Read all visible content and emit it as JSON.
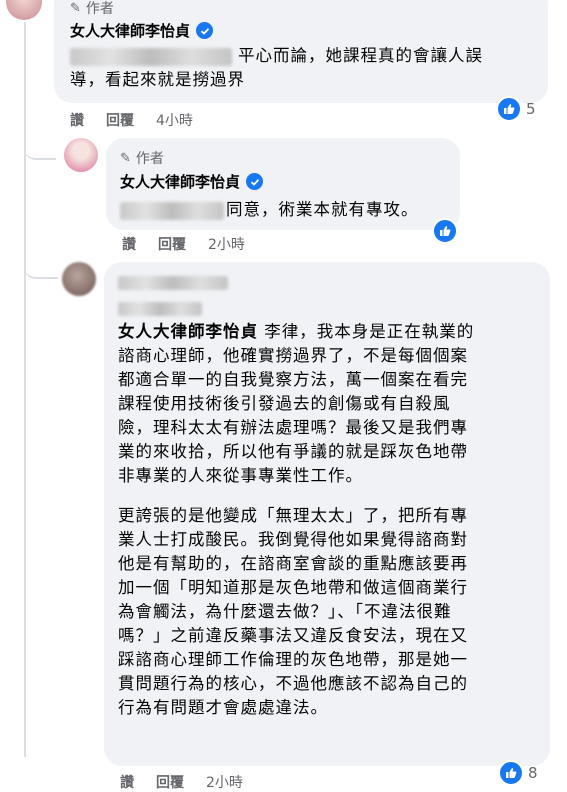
{
  "comment1": {
    "author_badge": "作者",
    "name": "女人大律師李怡貞",
    "text": "平心而論，她課程真的會讓人誤導，看起來就是撈過界",
    "line1": "平心而論，她課程真的會讓人誤",
    "line2": "導，看起來就是撈過界",
    "actions": {
      "like": "讚",
      "reply": "回覆",
      "time": "4小時"
    },
    "reactions": "5"
  },
  "comment2": {
    "author_badge": "作者",
    "name": "女人大律師李怡貞",
    "text": "同意，術業本就有專攻。",
    "actions": {
      "like": "讚",
      "reply": "回覆",
      "time": "2小時"
    }
  },
  "comment3": {
    "mention": "女人大律師李怡貞",
    "para1_first": " 李律，我本身是正在執業的",
    "para1_lines": [
      "諮商心理師，他確實撈過界了，不是每個個案",
      "都適合單一的自我覺察方法，萬一個案在看完",
      "課程使用技術後引發過去的創傷或有自殺風",
      "險，理科太太有辦法處理嗎？最後又是我們專",
      "業的來收拾，所以他有爭議的就是踩灰色地帶",
      "非專業的人來從事專業性工作。"
    ],
    "para2_lines": [
      "更誇張的是他變成「無理太太」了，把所有專",
      "業人士打成酸民。我倒覺得他如果覺得諮商對",
      "他是有幫助的，在諮商室會談的重點應該要再",
      "加一個「明知道那是灰色地帶和做這個商業行",
      "為會觸法，為什麼還去做？」、「不違法很難",
      "嗎？」之前違反藥事法又違反食安法，現在又",
      "踩諮商心理師工作倫理的灰色地帶，那是她一",
      "貫問題行為的核心，不過他應該不認為自己的",
      "行為有問題才會處處違法。"
    ],
    "actions": {
      "like": "讚",
      "reply": "回覆",
      "time": "2小時"
    },
    "reactions": "8"
  },
  "colors": {
    "accent": "#1877f2",
    "bubble": "#f0f2f5",
    "meta": "#65676b"
  }
}
